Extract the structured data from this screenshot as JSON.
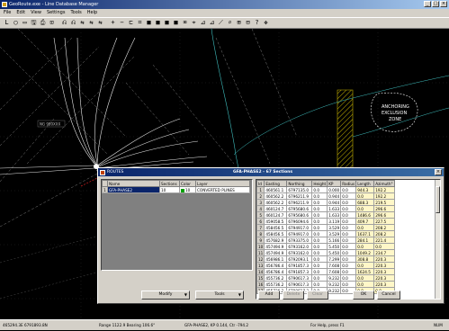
{
  "window": {
    "title": "GeoRoute.exe - Line Database Manager"
  },
  "menu": [
    "File",
    "Edit",
    "View",
    "Settings",
    "Tools",
    "Help"
  ],
  "toolbar": [
    "L",
    "◯",
    "▭",
    "🖫",
    "⎙",
    "⊡",
    "⎌",
    "⎌",
    "⇆",
    "⇆",
    "⇆",
    "+",
    "−",
    "⊏",
    "⌗",
    "■",
    "■",
    "■",
    "■",
    "⌧",
    "⌖",
    "⊿",
    "⊿",
    "⟋",
    "⌕",
    "⊞",
    "⊟",
    "?",
    "✥"
  ],
  "map": {
    "anchoring_label_1": "ANCHORING",
    "anchoring_label_2": "EXCLUSION",
    "anchoring_label_3": "ZONE",
    "small_label": "NG 980XXX"
  },
  "dialog": {
    "title_left": "ROUTES",
    "title_center": "GFA-PHASE2 - 67 Sections",
    "routes": {
      "headers": [
        "Name",
        "Sections",
        "Color",
        "Layer"
      ],
      "rows": [
        {
          "idx": "1",
          "name": "GFA-PHASE2",
          "sections": "10",
          "color_id": "10",
          "layer": "CONVERTED PLINES"
        }
      ]
    },
    "sections": {
      "headers": [
        "Id",
        "Easting",
        "Northing",
        "Height",
        "KP",
        "Radius",
        "Length",
        "Azimuth°"
      ],
      "rows": [
        [
          "1",
          "460561.1",
          "6797135.0",
          "0.0",
          "0.000",
          "0.0",
          "944.3",
          "192.2"
        ],
        [
          "2",
          "460562.2",
          "6796211.9",
          "0.0",
          "0.944",
          "0.0",
          "0.0",
          "192.2"
        ],
        [
          "3",
          "460562.2",
          "6796211.9",
          "0.0",
          "0.944",
          "0.0",
          "688.3",
          "219.5"
        ],
        [
          "4",
          "460124.7",
          "6795680.6",
          "0.0",
          "1.633",
          "0.0",
          "0.0",
          "296.6"
        ],
        [
          "5",
          "460124.7",
          "6795680.6",
          "0.0",
          "1.633",
          "0.0",
          "1486.6",
          "296.6"
        ],
        [
          "6",
          "459058.5",
          "6796094.6",
          "0.0",
          "3.119",
          "0.0",
          "409.7",
          "227.5"
        ],
        [
          "7",
          "458456.5",
          "6794917.0",
          "0.0",
          "3.529",
          "0.0",
          "0.0",
          "208.2"
        ],
        [
          "8",
          "458456.5",
          "6794917.0",
          "0.0",
          "3.529",
          "0.0",
          "1637.1",
          "208.2"
        ],
        [
          "9",
          "457682.9",
          "6793375.0",
          "0.0",
          "5.166",
          "0.0",
          "284.1",
          "221.4"
        ],
        [
          "10",
          "457494.9",
          "6793162.0",
          "0.0",
          "5.450",
          "0.0",
          "0.0",
          "0.0"
        ],
        [
          "11",
          "457494.9",
          "6793162.0",
          "0.0",
          "5.450",
          "0.0",
          "1049.2",
          "234.7"
        ],
        [
          "12",
          "456986.1",
          "6792093.1",
          "0.0",
          "7.299",
          "0.0",
          "308.8",
          "220.3"
        ],
        [
          "13",
          "456786.4",
          "6791857.3",
          "0.0",
          "7.608",
          "0.0",
          "0.0",
          "220.3"
        ],
        [
          "14",
          "456786.4",
          "6791857.3",
          "0.0",
          "7.608",
          "0.0",
          "1624.5",
          "220.3"
        ],
        [
          "15",
          "455736.2",
          "6790617.3",
          "0.0",
          "9.232",
          "0.0",
          "0.0",
          "220.3"
        ],
        [
          "16",
          "455736.2",
          "6790617.3",
          "0.0",
          "9.232",
          "0.0",
          "0.0",
          "220.3"
        ],
        [
          "17",
          "455736.2",
          "6790617.3",
          "0.0",
          "9.232",
          "0.0",
          "0.0",
          "0.0"
        ]
      ]
    },
    "buttons": {
      "modify": "Modify",
      "tools": "Tools",
      "add": "Add",
      "delete": "Delete",
      "clear": "Clear",
      "ok": "OK",
      "cancel": "Cancel"
    }
  },
  "status": {
    "coords": "465294.3E 6791893.8N",
    "range": "Range 1122.9 Bearing 106.6°",
    "route_info": "GFA-PHASE2, KP 0.144, Ctr -794.2",
    "help": "For Help, press F1",
    "mode": "NUM"
  }
}
